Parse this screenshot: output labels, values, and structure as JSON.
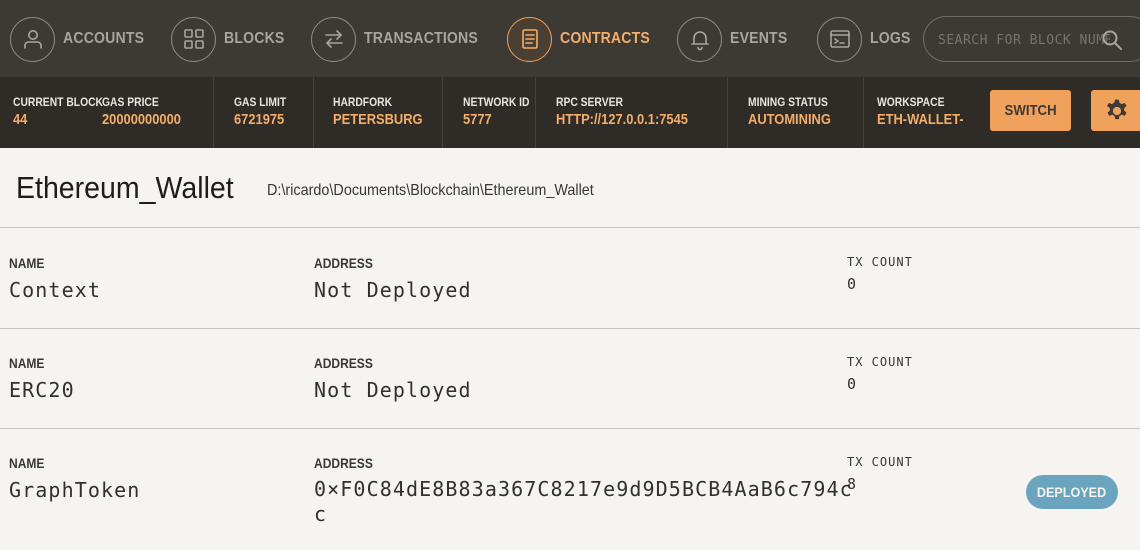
{
  "nav": {
    "items": [
      {
        "label": "ACCOUNTS",
        "icon": "person-icon"
      },
      {
        "label": "BLOCKS",
        "icon": "grid-icon"
      },
      {
        "label": "TRANSACTIONS",
        "icon": "swap-icon"
      },
      {
        "label": "CONTRACTS",
        "icon": "document-icon",
        "active": true
      },
      {
        "label": "EVENTS",
        "icon": "bell-icon"
      },
      {
        "label": "LOGS",
        "icon": "terminal-icon"
      }
    ],
    "search_placeholder": "SEARCH FOR BLOCK NUMBERS OR TX HASHES"
  },
  "status": {
    "current_block": {
      "label": "CURRENT BLOCK",
      "value": "44"
    },
    "gas_price": {
      "label": "GAS PRICE",
      "value": "20000000000"
    },
    "gas_limit": {
      "label": "GAS LIMIT",
      "value": "6721975"
    },
    "hardfork": {
      "label": "HARDFORK",
      "value": "PETERSBURG"
    },
    "network_id": {
      "label": "NETWORK ID",
      "value": "5777"
    },
    "rpc_server": {
      "label": "RPC SERVER",
      "value": "HTTP://127.0.0.1:7545"
    },
    "mining_status": {
      "label": "MINING STATUS",
      "value": "AUTOMINING"
    },
    "workspace": {
      "label": "WORKSPACE",
      "value": "ETH-WALLET-AVOCADO"
    },
    "switch_label": "SWITCH"
  },
  "project": {
    "title": "Ethereum_Wallet",
    "path": "D:\\ricardo\\Documents\\Blockchain\\Ethereum_Wallet"
  },
  "contracts": {
    "name_label": "NAME",
    "address_label": "ADDRESS",
    "tx_label": "TX COUNT",
    "rows": [
      {
        "name": "Context",
        "address": "Not Deployed",
        "tx_count": "0"
      },
      {
        "name": "ERC20",
        "address": "Not Deployed",
        "tx_count": "0"
      },
      {
        "name": "GraphToken",
        "address": "0×F0C84dE8B83a367C8217e9d9D5BCB4AaB6c794cc",
        "tx_count": "8",
        "badge": "DEPLOYED"
      }
    ]
  },
  "colors": {
    "nav_bg": "#3d3935",
    "status_bg": "#2f2b27",
    "accent": "#f0a25c",
    "badge": "#6aa4bf",
    "page_bg": "#f5f4f0"
  }
}
